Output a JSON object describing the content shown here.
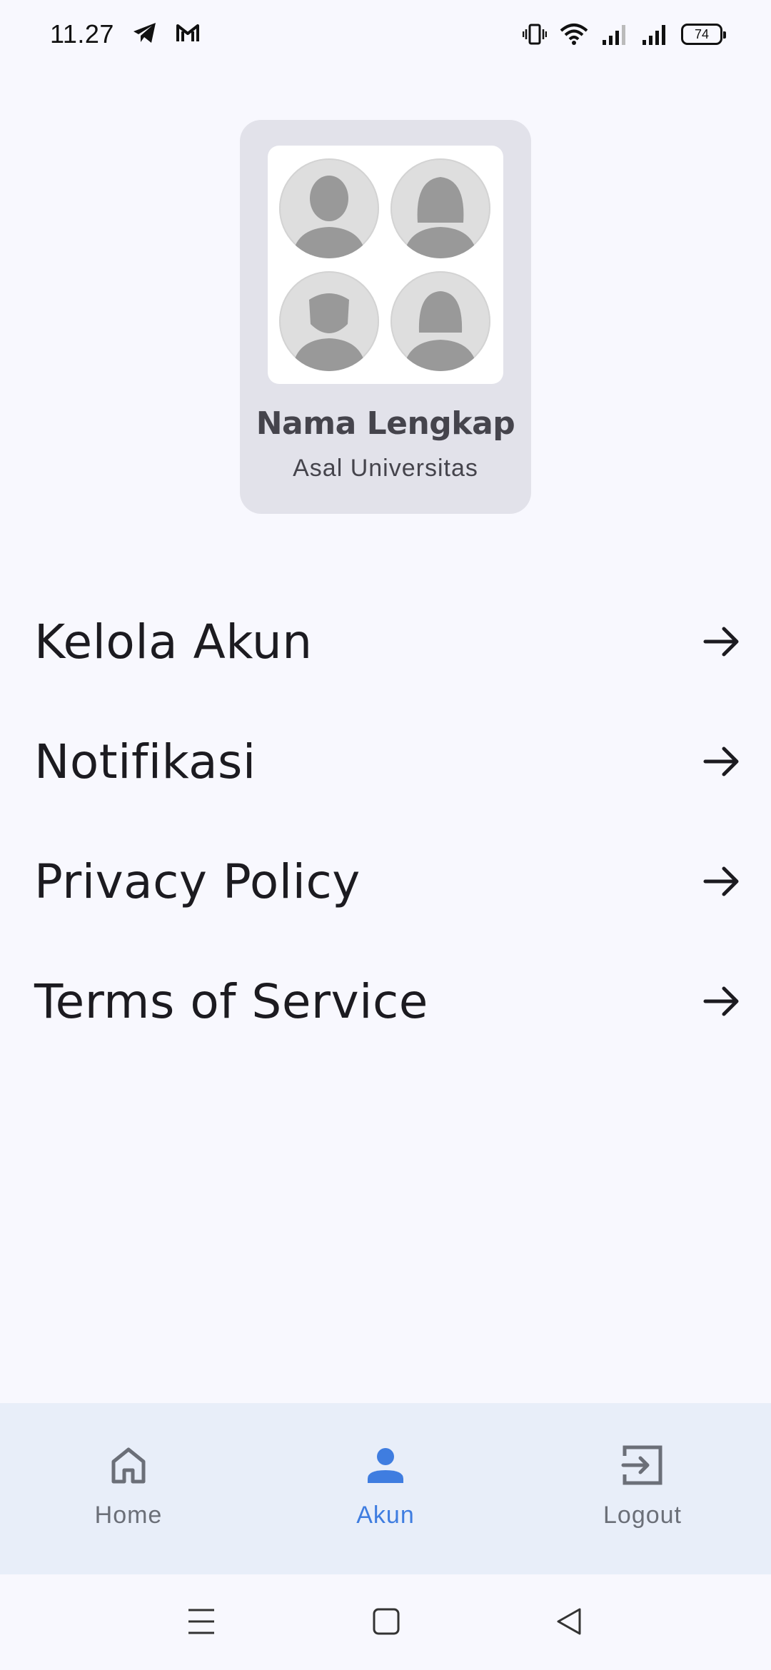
{
  "status_bar": {
    "time": "11.27",
    "battery": "74",
    "icons": [
      "telegram-icon",
      "gmail-icon",
      "vibrate-icon",
      "wifi-icon",
      "signal-icon",
      "signal-icon",
      "battery-icon"
    ]
  },
  "profile": {
    "name": "Nama Lengkap",
    "university": "Asal Universitas"
  },
  "menu": {
    "items": [
      {
        "label": "Kelola Akun",
        "icon": "arrow-right-icon"
      },
      {
        "label": "Notifikasi",
        "icon": "arrow-right-icon"
      },
      {
        "label": "Privacy Policy",
        "icon": "arrow-right-icon"
      },
      {
        "label": "Terms of Service",
        "icon": "arrow-right-icon"
      }
    ]
  },
  "bottom_nav": {
    "items": [
      {
        "label": "Home",
        "icon": "home-icon",
        "active": false
      },
      {
        "label": "Akun",
        "icon": "person-icon",
        "active": true
      },
      {
        "label": "Logout",
        "icon": "logout-icon",
        "active": false
      }
    ]
  },
  "colors": {
    "background": "#f8f8fe",
    "card": "#e2e2ea",
    "nav_background": "#e8eef9",
    "accent": "#3f7de0",
    "inactive": "#6b6f78"
  }
}
